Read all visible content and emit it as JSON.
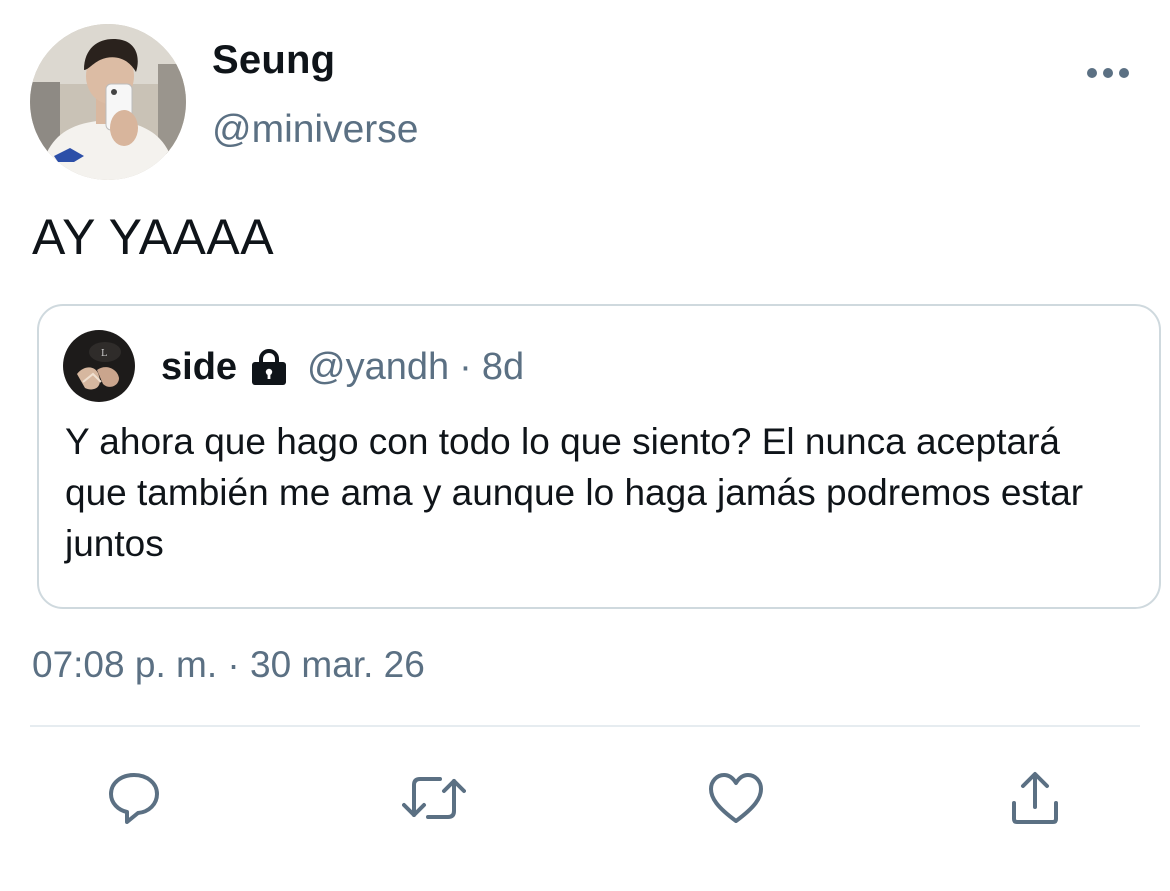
{
  "tweet": {
    "author": {
      "display_name": "Seung",
      "handle": "@miniverse"
    },
    "text": "AY YAAAA",
    "timestamp": "07:08 p. m. · 30 mar. 26"
  },
  "quoted_tweet": {
    "author": {
      "display_name": "side",
      "handle": "@yandh",
      "protected_icon": "lock-icon"
    },
    "separator": "·",
    "age": "8d",
    "text": "Y ahora que hago con todo lo que siento? El nunca aceptará que también me ama y aunque lo haga jamás podremos estar juntos"
  },
  "actions": {
    "icons": [
      "reply-icon",
      "retweet-icon",
      "like-icon",
      "share-icon"
    ]
  },
  "colors": {
    "text": "#0f1419",
    "secondary": "#5b7083",
    "border": "#cfd9de"
  }
}
